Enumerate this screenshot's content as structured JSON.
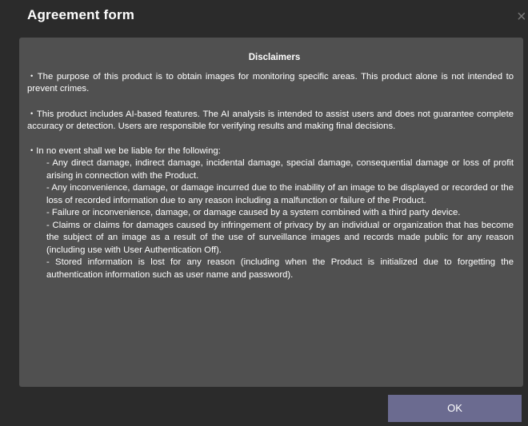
{
  "dialog": {
    "title": "Agreement form",
    "close_glyph": "×",
    "ok_label": "OK"
  },
  "disclaimer": {
    "heading": "Disclaimers",
    "paragraph_1": "・The purpose of this product is to obtain images for monitoring specific areas. This product alone is not intended to prevent crimes.",
    "paragraph_2": "・This product includes AI-based features. The AI analysis is intended to assist users and does not guarantee complete accuracy or detection. Users are responsible for verifying results and making final decisions.",
    "paragraph_3_intro": "・In no event shall we be liable for the following:",
    "items": [
      "- Any direct damage, indirect damage, incidental damage, special damage, consequential damage or loss of profit arising in connection with the Product.",
      "- Any inconvenience, damage, or damage incurred due to the inability of an image to be displayed or recorded or the loss of recorded information due to any reason including a malfunction or failure of the Product.",
      "- Failure or inconvenience, damage, or damage caused by a system combined with a third party device.",
      "- Claims or claims for damages caused by infringement of privacy by an individual or organization that has become the subject of an image as a result of the use of surveillance images and records made public for any reason (including use with User Authentication Off).",
      "- Stored information is lost for any reason (including when the Product is initialized due to forgetting the authentication information such as user name and password)."
    ]
  },
  "colors": {
    "background": "#2b2b2b",
    "panel": "#505050",
    "ok_button": "#6b6b90",
    "text": "#ffffff"
  }
}
